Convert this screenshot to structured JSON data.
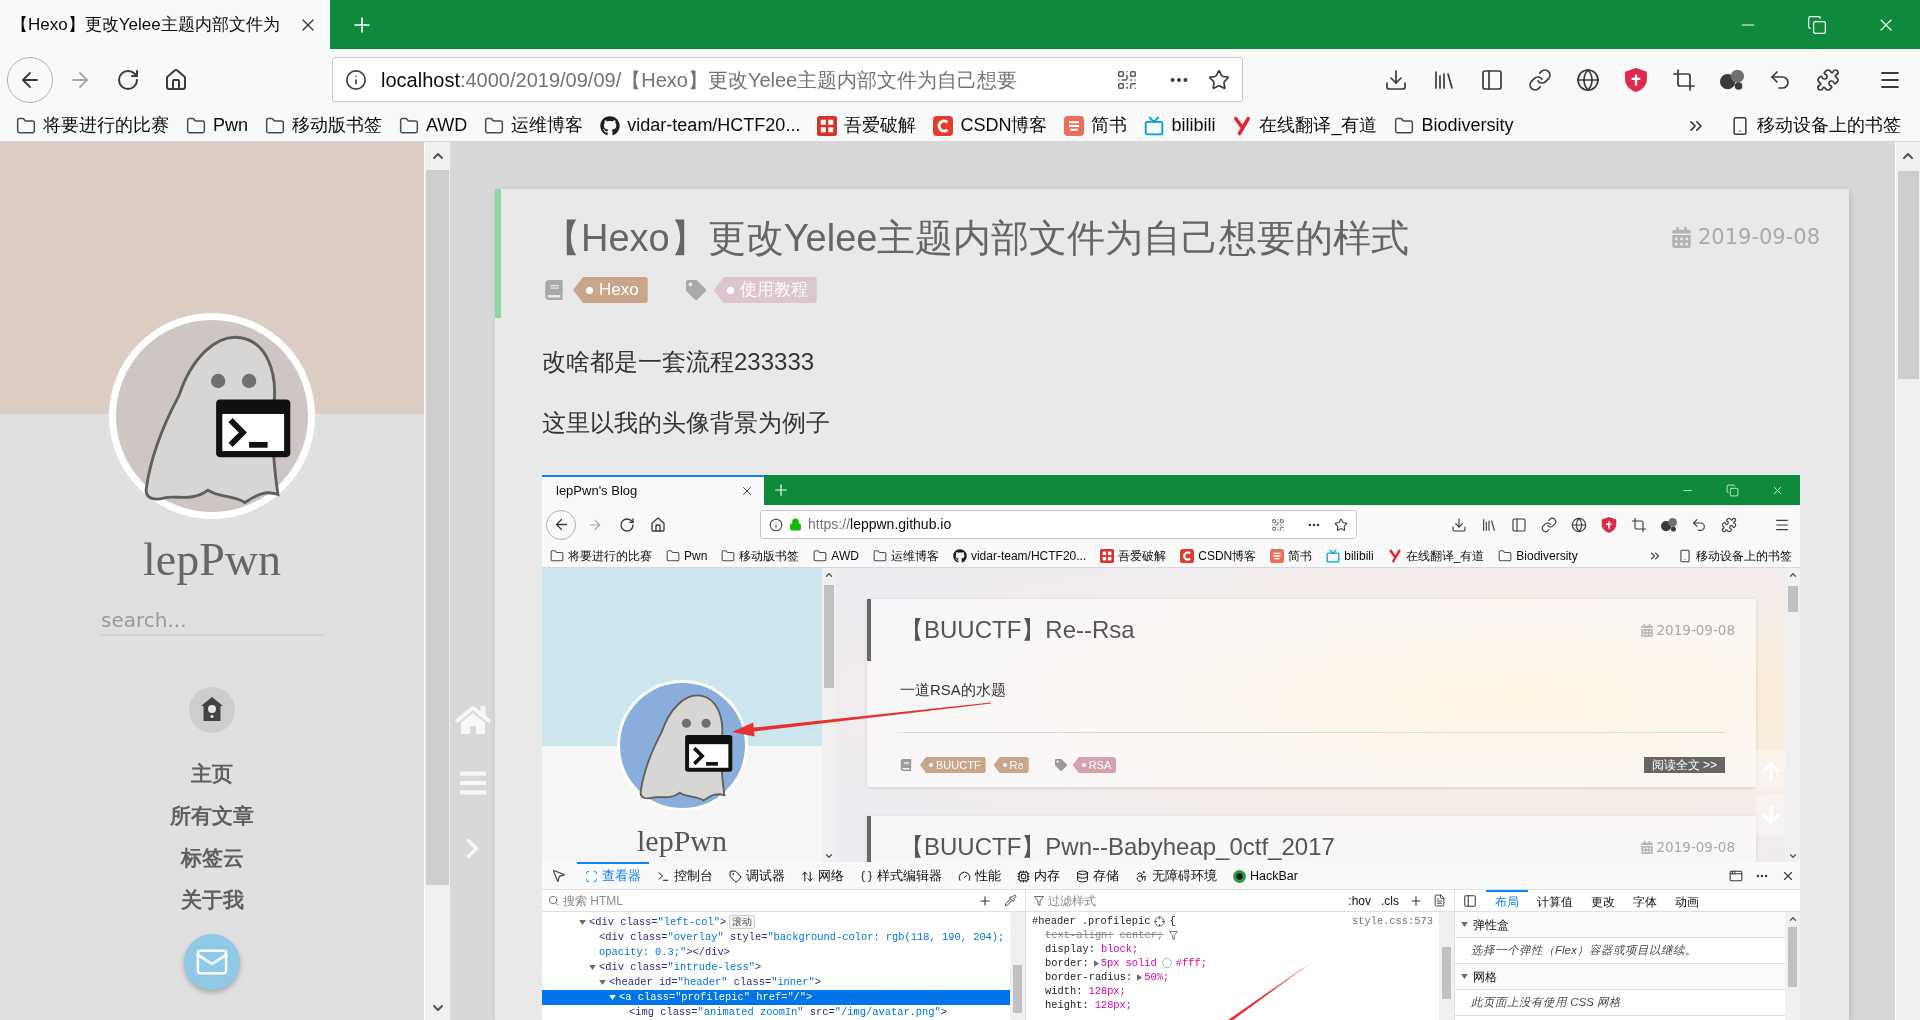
{
  "browser": {
    "tab": {
      "title": "【Hexo】更改Yelee主题内部文件为"
    },
    "address": {
      "host": "localhost",
      "path": ":4000/2019/09/09/【Hexo】更改Yelee主题内部文件为自己想要",
      "secure": false
    },
    "bookmarks": [
      {
        "kind": "folder",
        "label": "将要进行的比赛"
      },
      {
        "kind": "folder",
        "label": "Pwn"
      },
      {
        "kind": "folder",
        "label": "移动版书签"
      },
      {
        "kind": "folder",
        "label": "AWD"
      },
      {
        "kind": "folder",
        "label": "运维博客"
      },
      {
        "kind": "github",
        "label": "vidar-team/HCTF20..."
      },
      {
        "kind": "pojie",
        "label": "吾爱破解"
      },
      {
        "kind": "csdn",
        "label": "CSDN博客"
      },
      {
        "kind": "jianshu",
        "label": "简书"
      },
      {
        "kind": "bilibili",
        "label": "bilibili"
      },
      {
        "kind": "youdao",
        "label": "在线翻译_有道"
      },
      {
        "kind": "folder",
        "label": "Biodiversity"
      }
    ],
    "other_bookmarks": "移动设备上的书签"
  },
  "sidebar": {
    "name": "lepPwn",
    "search": {
      "placeholder": "search..."
    },
    "nav": [
      {
        "label": "主页"
      },
      {
        "label": "所有文章"
      },
      {
        "label": "标签云"
      },
      {
        "label": "关于我"
      }
    ]
  },
  "post": {
    "title": "【Hexo】更改Yelee主题内部文件为自己想要的样式",
    "date": "2019-09-08",
    "categories": [
      "Hexo"
    ],
    "tags": [
      "使用教程"
    ],
    "paragraphs": [
      "改啥都是一套流程233333",
      "这里以我的头像背景为例子"
    ],
    "screenshot": {
      "browser": {
        "tab": {
          "title": "lepPwn's Blog"
        },
        "address": {
          "scheme": "https://",
          "host": "leppwn.github.io",
          "secure": true
        },
        "bookmarks": [
          {
            "kind": "folder",
            "label": "将要进行的比赛"
          },
          {
            "kind": "folder",
            "label": "Pwn"
          },
          {
            "kind": "folder",
            "label": "移动版书签"
          },
          {
            "kind": "folder",
            "label": "AWD"
          },
          {
            "kind": "folder",
            "label": "运维博客"
          },
          {
            "kind": "github",
            "label": "vidar-team/HCTF20..."
          },
          {
            "kind": "pojie",
            "label": "吾爱破解"
          },
          {
            "kind": "csdn",
            "label": "CSDN博客"
          },
          {
            "kind": "jianshu",
            "label": "简书"
          },
          {
            "kind": "bilibili",
            "label": "bilibili"
          },
          {
            "kind": "youdao",
            "label": "在线翻译_有道"
          },
          {
            "kind": "folder",
            "label": "Biodiversity"
          }
        ],
        "other_bookmarks": "移动设备上的书签"
      },
      "sidebar": {
        "name": "lepPwn"
      },
      "posts": [
        {
          "title": "【BUUCTF】Re--Rsa",
          "date": "2019-09-08",
          "excerpt": "一道RSA的水题",
          "categories": [
            "BUUCTF",
            "Re"
          ],
          "tags": [
            "RSA"
          ],
          "read_more": "阅读全文 >>"
        },
        {
          "title": "【BUUCTF】Pwn--Babyheap_0ctf_2017",
          "date": "2019-09-08"
        }
      ],
      "devtools": {
        "tabs": [
          {
            "kind": "inspector",
            "label": "查看器",
            "selected": true
          },
          {
            "kind": "console",
            "label": "控制台",
            "selected": false
          },
          {
            "kind": "debugger",
            "label": "调试器",
            "selected": false
          },
          {
            "kind": "network",
            "label": "网络",
            "selected": false
          },
          {
            "kind": "style-editor",
            "label": "样式编辑器",
            "selected": false
          },
          {
            "kind": "performance",
            "label": "性能",
            "selected": false
          },
          {
            "kind": "memory",
            "label": "内存",
            "selected": false
          },
          {
            "kind": "storage",
            "label": "存储",
            "selected": false
          },
          {
            "kind": "accessibility",
            "label": "无障碍环境",
            "selected": false
          },
          {
            "kind": "hackbar",
            "label": "HackBar",
            "selected": false
          }
        ],
        "markup": {
          "search": {
            "placeholder": "搜索 HTML"
          },
          "nodes": [
            {
              "code": "<div class=\"left-col\">",
              "badge": "滚动",
              "expanded": true,
              "selected": false,
              "children": [
                {
                  "code": "<div class=\"overlay\" style=\"background-color: rgb(118, 190, 204); opacity: 0.3;\"></div>",
                  "expanded": false,
                  "selected": false
                },
                {
                  "code": "<div class=\"intrude-less\">",
                  "expanded": true,
                  "selected": false,
                  "children": [
                    {
                      "code": "<header id=\"header\" class=\"inner\">",
                      "expanded": true,
                      "selected": false,
                      "children": [
                        {
                          "code": "<a class=\"profilepic\" href=\"/\">",
                          "expanded": true,
                          "selected": true,
                          "children": [
                            {
                              "code": "<img class=\"animated zoomIn\" src=\"/img/avatar.png\">",
                              "expanded": false,
                              "selected": false
                            }
                          ]
                        }
                      ]
                    }
                  ]
                }
              ]
            }
          ]
        },
        "rules": {
          "filter": {
            "placeholder": "过滤样式"
          },
          "buttons": [
            ":hov",
            ".cls"
          ],
          "selector": "#header .profilepic",
          "brace": "{",
          "source": "style.css:573",
          "declarations": [
            {
              "property": "text-align:",
              "value": "center;",
              "overridden": true,
              "expandable": false
            },
            {
              "property": "display:",
              "value": "block;",
              "overridden": false,
              "expandable": false
            },
            {
              "property": "border:",
              "value": "5px solid",
              "color": "#ffffff",
              "color_value": "#fff;",
              "overridden": false,
              "expandable": true
            },
            {
              "property": "border-radius:",
              "value": "50%;",
              "overridden": false,
              "expandable": true
            },
            {
              "property": "width:",
              "value": "128px;",
              "overridden": false,
              "expandable": false
            },
            {
              "property": "height:",
              "value": "128px;",
              "overridden": false,
              "expandable": false
            }
          ]
        },
        "layout": {
          "tabs": [
            {
              "label": "布局",
              "selected": true
            },
            {
              "label": "计算值",
              "selected": false
            },
            {
              "label": "更改",
              "selected": false
            },
            {
              "label": "字体",
              "selected": false
            },
            {
              "label": "动画",
              "selected": false
            }
          ],
          "sections": [
            {
              "title": "弹性盒",
              "expanded": true,
              "message": "选择一个弹性（Flex）容器或项目以继续。"
            },
            {
              "title": "网格",
              "expanded": true,
              "message": "此页面上没有使用 CSS 网格"
            }
          ]
        }
      }
    }
  }
}
